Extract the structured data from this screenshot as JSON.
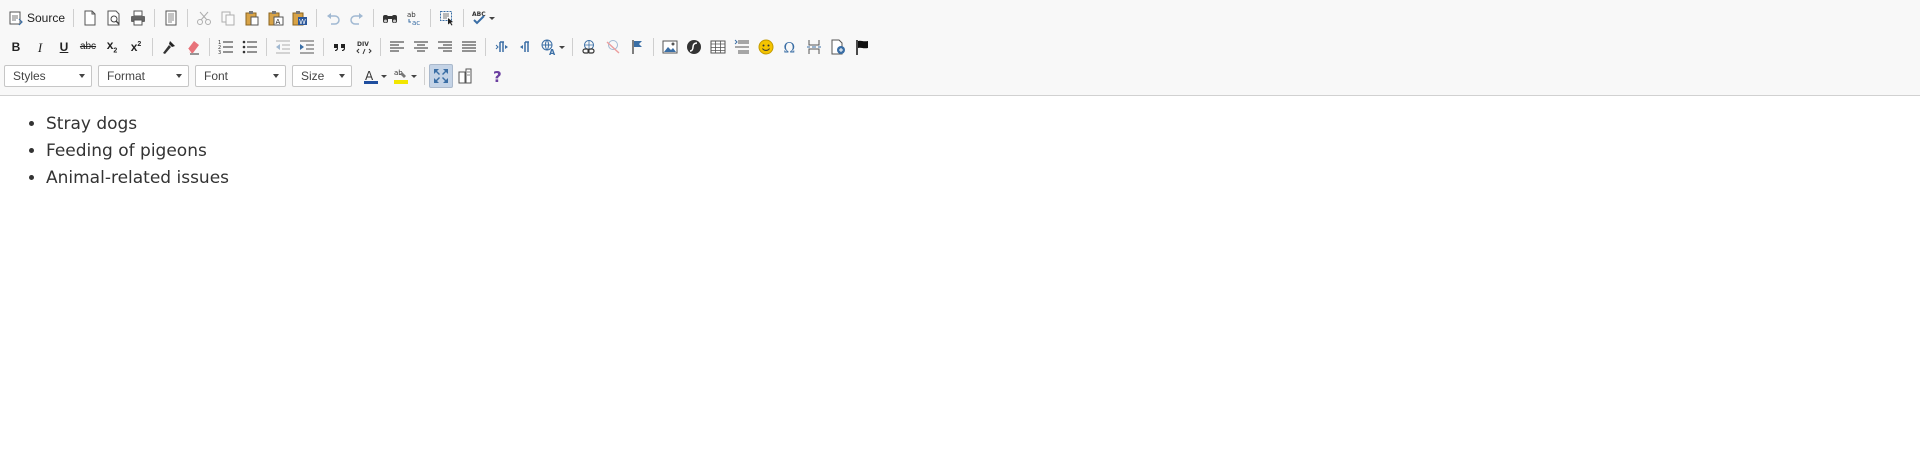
{
  "toolbar": {
    "source_label": "Source",
    "combos": {
      "styles": "Styles",
      "format": "Format",
      "font": "Font",
      "size": "Size"
    },
    "text_buttons": {
      "bold": "B",
      "italic": "I",
      "underline": "U",
      "strike": "abc",
      "subscript": "x",
      "superscript": "x"
    },
    "colors": {
      "accent_blue": "#3a6ea5",
      "active_bg": "#c4d3e6",
      "icon_dark": "#333333",
      "text_color_bar": "#1f4e9e",
      "highlight_bar": "#f2e600",
      "help_purple": "#6b3fa0",
      "smiley": "#f5c400"
    },
    "icons": [
      "source-icon",
      "new-page-icon",
      "preview-icon",
      "print-icon",
      "templates-icon",
      "cut-icon",
      "copy-icon",
      "paste-icon",
      "paste-text-icon",
      "paste-word-icon",
      "undo-icon",
      "redo-icon",
      "find-icon",
      "replace-icon",
      "select-all-icon",
      "spellcheck-icon",
      "copy-formatting-icon",
      "remove-format-icon",
      "numbered-list-icon",
      "bulleted-list-icon",
      "outdent-icon",
      "indent-icon",
      "blockquote-icon",
      "div-icon",
      "align-left-icon",
      "align-center-icon",
      "align-right-icon",
      "justify-icon",
      "ltr-icon",
      "rtl-icon",
      "language-icon",
      "link-icon",
      "unlink-icon",
      "anchor-icon",
      "image-icon",
      "flash-icon",
      "table-icon",
      "horizontal-rule-icon",
      "smiley-icon",
      "special-char-icon",
      "page-break-icon",
      "iframe-icon",
      "flag-icon",
      "text-color-icon",
      "bg-color-icon",
      "maximize-icon",
      "show-blocks-icon",
      "help-icon"
    ]
  },
  "editor": {
    "items": [
      "Stray dogs",
      "Feeding of pigeons",
      "Animal-related issues"
    ]
  }
}
